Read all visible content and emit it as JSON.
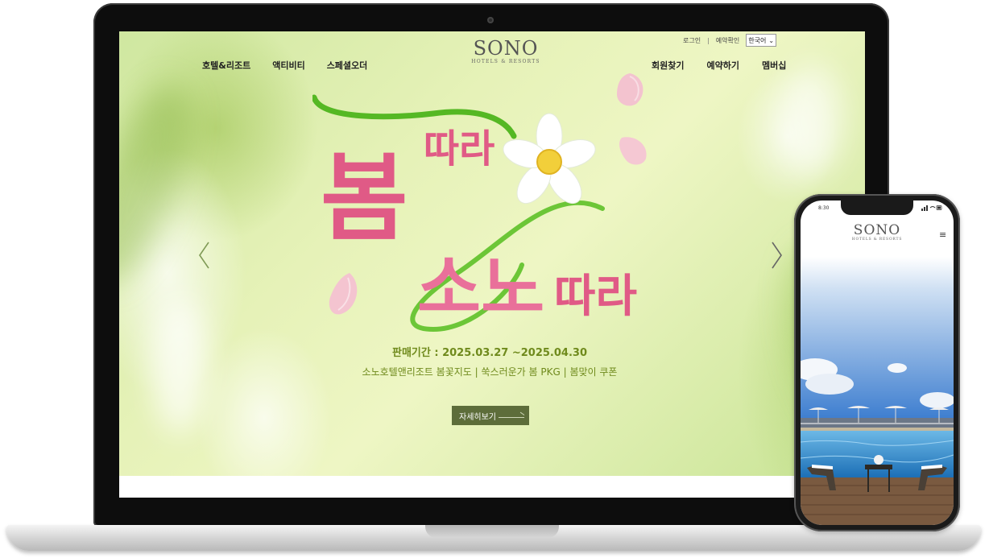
{
  "desktop": {
    "brand": {
      "name": "SONO",
      "sub": "HOTELS & RESORTS"
    },
    "utility": {
      "login": "로그인",
      "separator": "|",
      "reservation_check": "예약확인",
      "language": "한국어"
    },
    "nav_left": [
      "호텔&리조트",
      "액티비티",
      "스페셜오더"
    ],
    "nav_right": [
      "회원찾기",
      "예약하기",
      "멤버십"
    ],
    "hero": {
      "title_line1_big": "봄",
      "title_line1_small": "따라",
      "title_line2_big": "소노",
      "title_line2_small": "따라",
      "period": "판매기간 : 2025.03.27 ~2025.04.30",
      "description": "소노호텔앤리조트 봄꽃지도 | 쑥스러운가 봄 PKG | 봄맞이 쿠폰",
      "button": "자세히보기"
    }
  },
  "mobile": {
    "time": "8:30",
    "brand": {
      "name": "SONO",
      "sub": "HOTELS & RESORTS"
    },
    "menu_icon": "hamburger-icon"
  },
  "colors": {
    "title_pink": "#e05a86",
    "ribbon_green": "#5fbf2a",
    "period_green": "#6f8a1c",
    "button_bg": "#5d6d3a"
  }
}
